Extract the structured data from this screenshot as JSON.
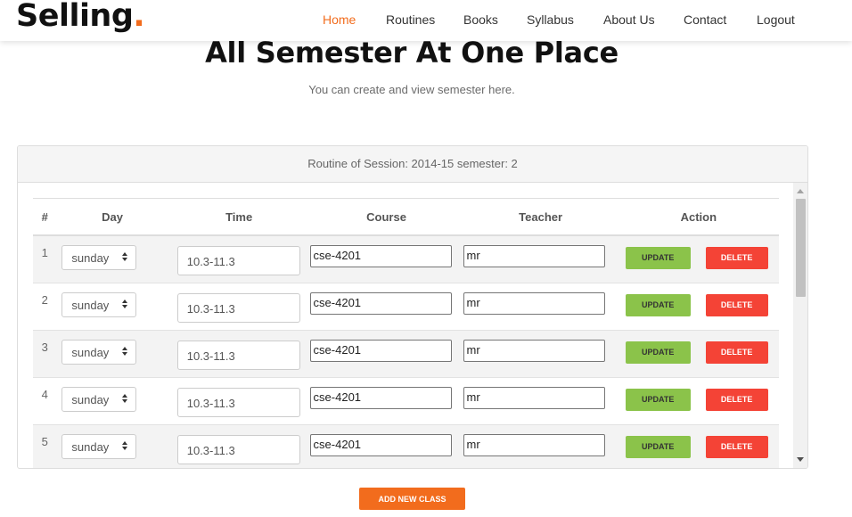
{
  "header": {
    "logo_text": "Selling",
    "logo_dot": ".",
    "nav": [
      {
        "label": "Home",
        "active": true
      },
      {
        "label": "Routines",
        "active": false
      },
      {
        "label": "Books",
        "active": false
      },
      {
        "label": "Syllabus",
        "active": false
      },
      {
        "label": "About Us",
        "active": false
      },
      {
        "label": "Contact",
        "active": false
      },
      {
        "label": "Logout",
        "active": false
      }
    ]
  },
  "hero": {
    "title": "All Semester At One Place",
    "subtitle": "You can create and view semester here."
  },
  "panel": {
    "heading": "Routine of Session: 2014-15 semester: 2",
    "columns": [
      "#",
      "Day",
      "Time",
      "Course",
      "Teacher",
      "Action"
    ],
    "rows": [
      {
        "num": "1",
        "day": "sunday",
        "time": "10.3-11.3",
        "course": "cse-4201",
        "teacher": "mr"
      },
      {
        "num": "2",
        "day": "sunday",
        "time": "10.3-11.3",
        "course": "cse-4201",
        "teacher": "mr"
      },
      {
        "num": "3",
        "day": "sunday",
        "time": "10.3-11.3",
        "course": "cse-4201",
        "teacher": "mr"
      },
      {
        "num": "4",
        "day": "sunday",
        "time": "10.3-11.3",
        "course": "cse-4201",
        "teacher": "mr"
      },
      {
        "num": "5",
        "day": "sunday",
        "time": "10.3-11.3",
        "course": "cse-4201",
        "teacher": "mr"
      }
    ],
    "update_label": "UPDATE",
    "delete_label": "DELETE"
  },
  "add_button_label": "ADD NEW CLASS",
  "colors": {
    "accent": "#f26c1d",
    "update": "#8bc34a",
    "delete": "#f44336"
  }
}
